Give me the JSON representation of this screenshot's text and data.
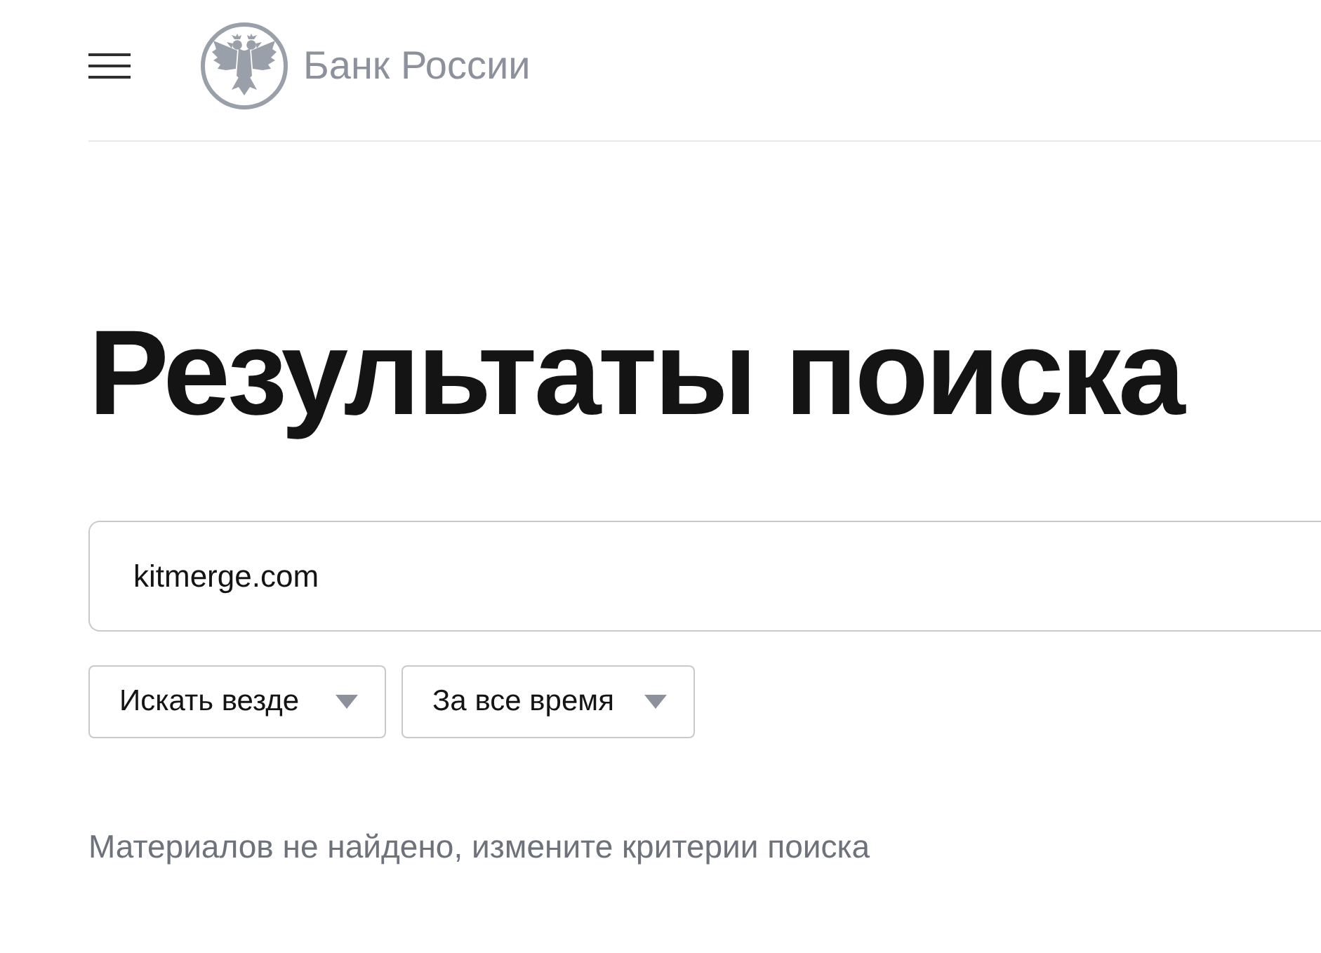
{
  "header": {
    "logo_text": "Банк России"
  },
  "page_title": "Результаты поиска",
  "search": {
    "value": "kitmerge.com"
  },
  "filters": [
    {
      "label": "Искать везде"
    },
    {
      "label": "За все время"
    }
  ],
  "message": "Материалов не найдено, измените критерии поиска"
}
